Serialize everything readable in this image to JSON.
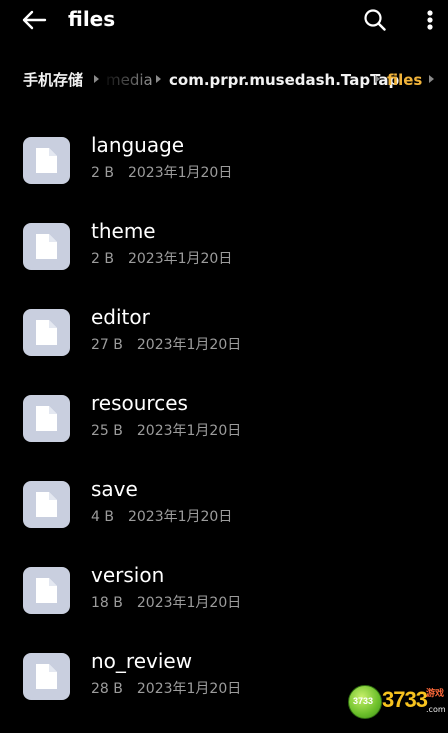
{
  "header": {
    "title": "files",
    "back_icon": "arrow-left-icon",
    "search_icon": "search-icon",
    "more_icon": "more-vertical-icon"
  },
  "breadcrumb": [
    {
      "label": "手机存储",
      "state": "normal"
    },
    {
      "label": "media",
      "state": "faded"
    },
    {
      "label": "com.prpr.musedash.TapTap",
      "state": "normal"
    },
    {
      "label": "files",
      "state": "active"
    }
  ],
  "colors": {
    "background": "#000000",
    "active_crumb": "#f0b33a",
    "file_icon_bg": "#c9cfdf",
    "meta_text": "#9c9c9c"
  },
  "files": [
    {
      "name": "language",
      "size": "2 B",
      "date": "2023年1月20日",
      "icon": "file-icon"
    },
    {
      "name": "theme",
      "size": "2 B",
      "date": "2023年1月20日",
      "icon": "file-icon"
    },
    {
      "name": "editor",
      "size": "27 B",
      "date": "2023年1月20日",
      "icon": "file-icon"
    },
    {
      "name": "resources",
      "size": "25 B",
      "date": "2023年1月20日",
      "icon": "file-icon"
    },
    {
      "name": "save",
      "size": "4 B",
      "date": "2023年1月20日",
      "icon": "file-icon"
    },
    {
      "name": "version",
      "size": "18 B",
      "date": "2023年1月20日",
      "icon": "file-icon"
    },
    {
      "name": "no_review",
      "size": "28 B",
      "date": "2023年1月20日",
      "icon": "file-icon"
    }
  ],
  "watermark": {
    "ball_text": "3733",
    "logo": "3733",
    "sub": "游戏",
    "domain": ".com"
  }
}
